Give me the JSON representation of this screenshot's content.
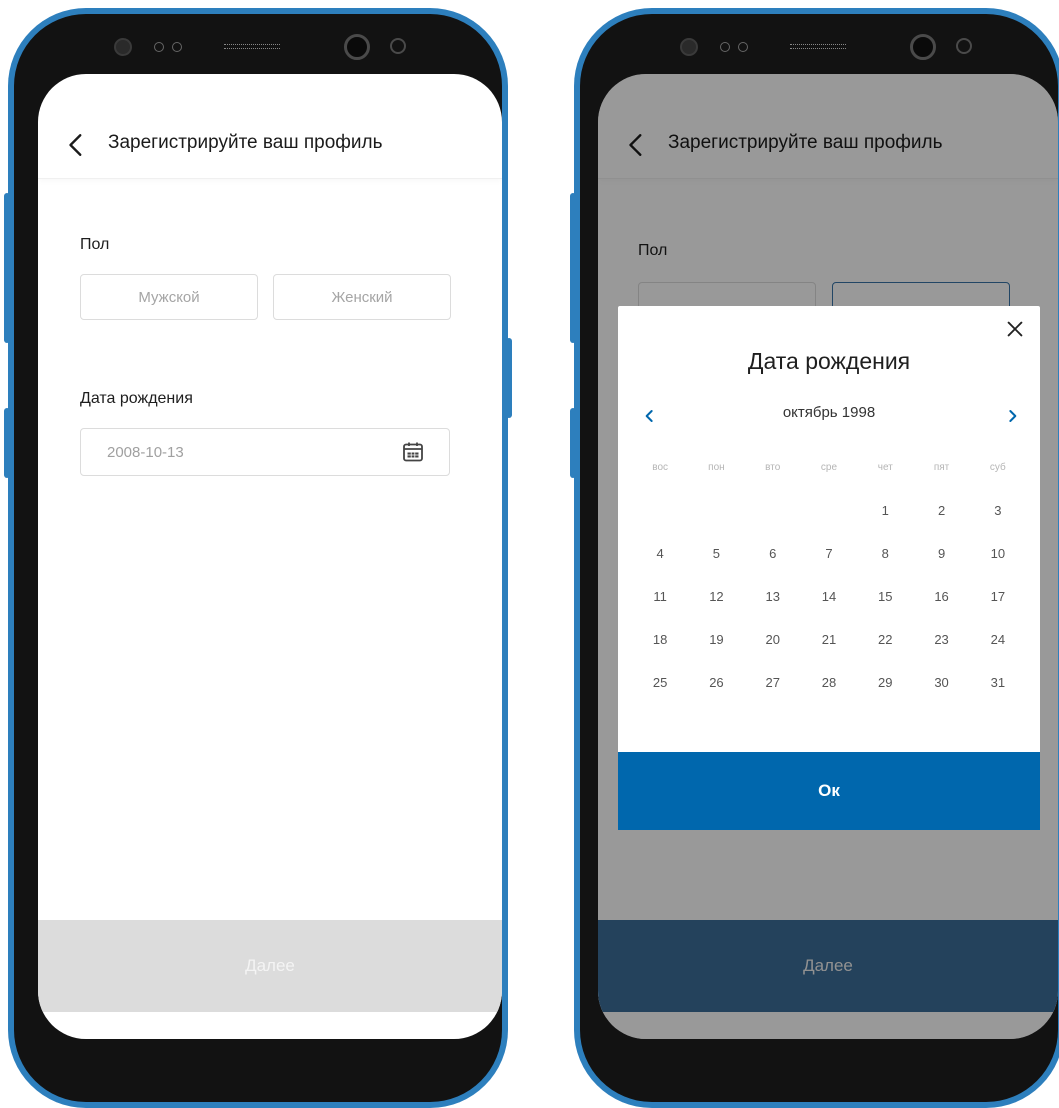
{
  "left_screen": {
    "header": {
      "title": "Зарегистрируйте ваш профиль"
    },
    "gender": {
      "label": "Пол",
      "male": "Мужской",
      "female": "Женский"
    },
    "birthdate": {
      "label": "Дата рождения",
      "value": "2008-10-13"
    },
    "footer": {
      "next_label": "Далее"
    }
  },
  "right_screen": {
    "header": {
      "title": "Зарегистрируйте ваш профиль"
    },
    "gender": {
      "label": "Пол"
    },
    "picker": {
      "title": "Дата рождения",
      "month": "октябрь 1998",
      "weekdays": [
        "вос",
        "пон",
        "вто",
        "сре",
        "чет",
        "пят",
        "суб"
      ],
      "weeks": [
        [
          "",
          "",
          "",
          "",
          "1",
          "2",
          "3"
        ],
        [
          "4",
          "5",
          "6",
          "7",
          "8",
          "9",
          "10"
        ],
        [
          "11",
          "12",
          "13",
          "14",
          "15",
          "16",
          "17"
        ],
        [
          "18",
          "19",
          "20",
          "21",
          "22",
          "23",
          "24"
        ],
        [
          "25",
          "26",
          "27",
          "28",
          "29",
          "30",
          "31"
        ]
      ],
      "ok_label": "Ок"
    },
    "footer": {
      "next_label": "Далее"
    }
  },
  "colors": {
    "accent": "#0067ad",
    "footer_disabled": "#dcdcdc",
    "footer_dimmed": "#244d70",
    "phone_frame": "#2d7fbd"
  }
}
